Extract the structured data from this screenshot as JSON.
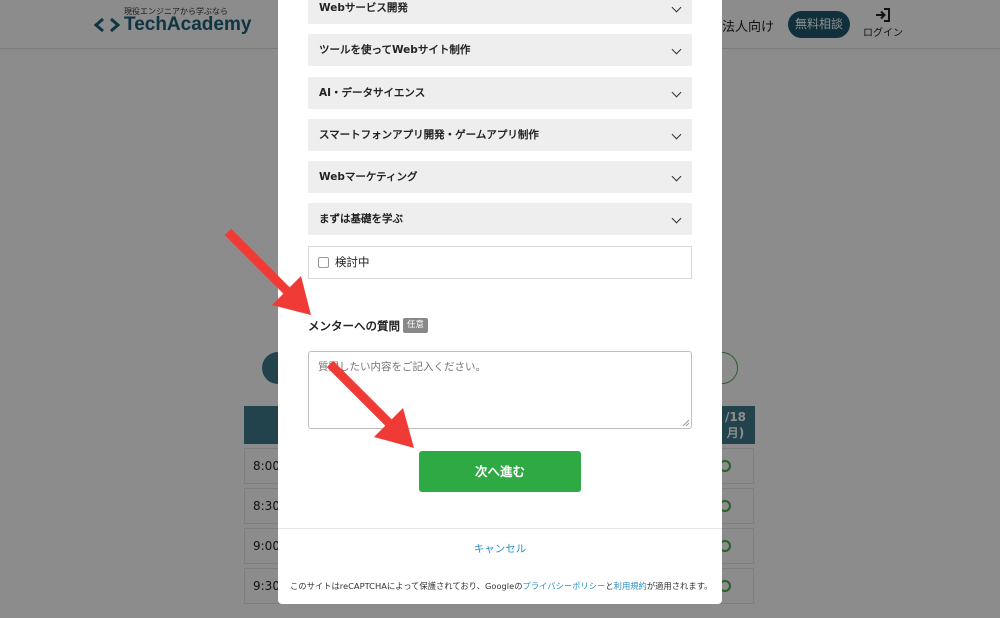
{
  "header": {
    "logo_tagline": "現役エンジニアから学ぶなら",
    "logo_text": "TechAcademy",
    "nav_corporate": "法人向け",
    "nav_consult": "無料相談",
    "nav_login": "ログイン"
  },
  "background": {
    "date_header": "/18",
    "date_header_day": "月)",
    "time_rows": [
      "8:00~",
      "8:30~",
      "9:00~",
      "9:30~"
    ]
  },
  "modal": {
    "categories": [
      {
        "label": "Webサービス開発"
      },
      {
        "label": "ツールを使ってWebサイト制作"
      },
      {
        "label": "AI・データサイエンス"
      },
      {
        "label": "スマートフォンアプリ開発・ゲームアプリ制作"
      },
      {
        "label": "Webマーケティング"
      },
      {
        "label": "まずは基礎を学ぶ"
      }
    ],
    "considering_label": "検討中",
    "considering_checked": false,
    "question_label": "メンターへの質問",
    "question_badge": "任意",
    "question_placeholder": "質問したい内容をご記入ください。",
    "question_value": "",
    "next_button": "次へ進む",
    "cancel_link": "キャンセル",
    "recaptcha": {
      "text_before": "このサイトはreCAPTCHAによって保護されており、Googleの",
      "privacy_link": "プライバシーポリシー",
      "text_and": "と",
      "terms_link": "利用規約",
      "text_after": "が適用されます。"
    }
  },
  "colors": {
    "brand_teal": "#1e5a6e",
    "button_green": "#2ea944",
    "link_blue": "#2c8fc0",
    "annotation_arrow": "#f03a35",
    "overlay": "rgba(0,0,0,0.45)"
  }
}
